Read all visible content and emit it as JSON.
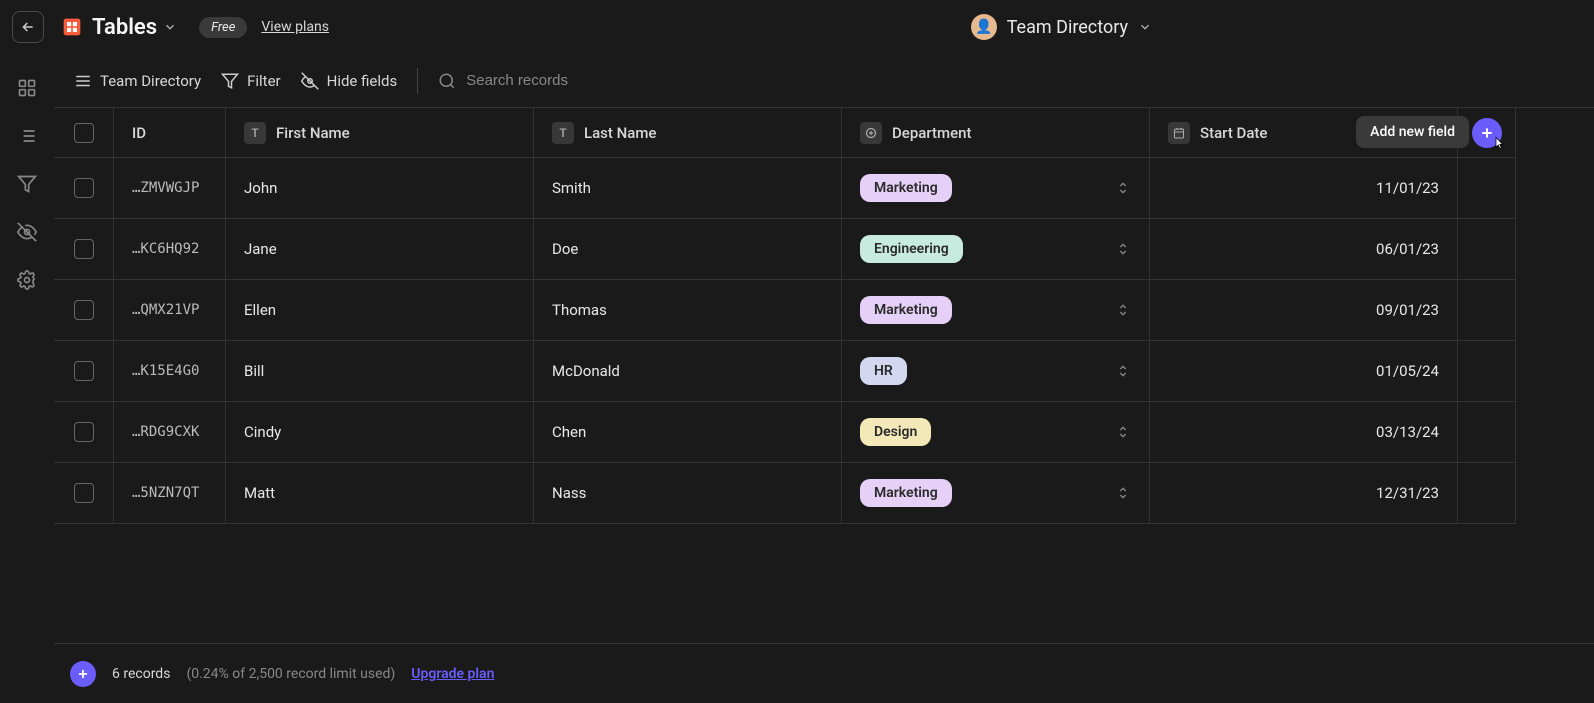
{
  "topbar": {
    "app_title": "Tables",
    "badge": "Free",
    "view_plans": "View plans",
    "workspace_title": "Team Directory"
  },
  "toolbar": {
    "table_name": "Team Directory",
    "filter": "Filter",
    "hide_fields": "Hide fields",
    "search_placeholder": "Search records"
  },
  "columns": {
    "id": "ID",
    "first_name": "First Name",
    "last_name": "Last Name",
    "department": "Department",
    "start_date": "Start Date"
  },
  "tooltip": {
    "add_field": "Add new field"
  },
  "rows": [
    {
      "id": "…ZMVWGJP",
      "first": "John",
      "last": "Smith",
      "dept": "Marketing",
      "deptClass": "pill-marketing",
      "date": "11/01/23"
    },
    {
      "id": "…KC6HQ92",
      "first": "Jane",
      "last": "Doe",
      "dept": "Engineering",
      "deptClass": "pill-engineering",
      "date": "06/01/23"
    },
    {
      "id": "…QMX21VP",
      "first": "Ellen",
      "last": "Thomas",
      "dept": "Marketing",
      "deptClass": "pill-marketing",
      "date": "09/01/23"
    },
    {
      "id": "…K15E4G0",
      "first": "Bill",
      "last": "McDonald",
      "dept": "HR",
      "deptClass": "pill-hr",
      "date": "01/05/24"
    },
    {
      "id": "…RDG9CXK",
      "first": "Cindy",
      "last": "Chen",
      "dept": "Design",
      "deptClass": "pill-design",
      "date": "03/13/24"
    },
    {
      "id": "…5NZN7QT",
      "first": "Matt",
      "last": "Nass",
      "dept": "Marketing",
      "deptClass": "pill-marketing",
      "date": "12/31/23"
    }
  ],
  "footer": {
    "record_count": "6 records",
    "usage": "(0.24% of 2,500 record limit used)",
    "upgrade": "Upgrade plan"
  }
}
